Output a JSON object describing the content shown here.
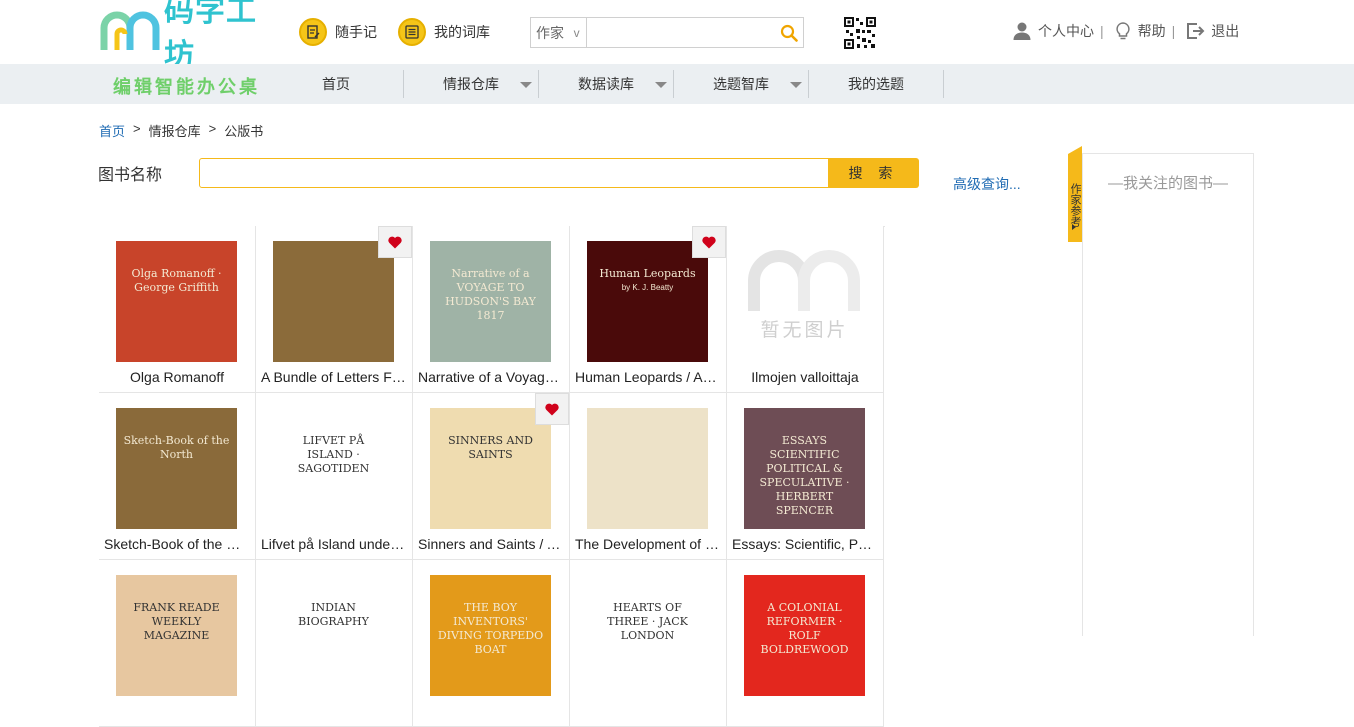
{
  "header": {
    "logo_text": "码字工坊",
    "quick_links": [
      {
        "label": "随手记",
        "icon": "note-edit-icon"
      },
      {
        "label": "我的词库",
        "icon": "list-icon"
      }
    ],
    "search": {
      "type_selected": "作家",
      "type_arrow": "v",
      "placeholder": ""
    },
    "user": {
      "center": "个人中心",
      "help": "帮助",
      "logout": "退出",
      "separator": "|"
    }
  },
  "nav": {
    "brand": "编辑智能办公桌",
    "items": [
      {
        "label": "首页",
        "has_dropdown": false
      },
      {
        "label": "情报仓库",
        "has_dropdown": true
      },
      {
        "label": "数据读库",
        "has_dropdown": true
      },
      {
        "label": "选题智库",
        "has_dropdown": true
      },
      {
        "label": "我的选题",
        "has_dropdown": false
      }
    ]
  },
  "breadcrumb": {
    "home": "首页",
    "level2": "情报仓库",
    "level3": "公版书",
    "sep": ">"
  },
  "book_search": {
    "label": "图书名称",
    "button": "搜 索",
    "advanced": "高级查询...",
    "value": ""
  },
  "side": {
    "tab": "作家参考",
    "panel_title": "—我关注的图书—"
  },
  "books": [
    {
      "title": "Olga Romanoff",
      "fav": false,
      "cover_text": "Olga Romanoff · George Griffith",
      "cover_bg": "#c8442a"
    },
    {
      "title": "A Bundle of Letters From Over the Sea",
      "fav": true,
      "cover_text": "",
      "cover_bg": "#8b6b3a"
    },
    {
      "title": "Narrative of a Voyage to Hudson's Bay",
      "fav": false,
      "cover_text": "Narrative of a VOYAGE TO HUDSON'S BAY 1817",
      "cover_bg": "#9fb3a6"
    },
    {
      "title": "Human Leopards / An Account",
      "fav": true,
      "cover_text": "Human Leopards",
      "cover_sub": "by K. J. Beatty",
      "cover_bg": "#4a0a0a"
    },
    {
      "title": "Ilmojen valloittaja",
      "fav": false,
      "cover_text": "暂无图片",
      "cover_bg": "#ffffff"
    },
    {
      "title": "Sketch-Book of the North",
      "fav": false,
      "cover_text": "Sketch-Book of the North",
      "cover_bg": "#8a6a3a"
    },
    {
      "title": "Lifvet på Island under Sagotiden",
      "fav": false,
      "cover_text": "LIFVET PÅ ISLAND · SAGOTIDEN",
      "cover_bg": "#ffffff"
    },
    {
      "title": "Sinners and Saints / A Tour",
      "fav": true,
      "cover_text": "SINNERS AND SAINTS",
      "cover_bg": "#efdcb0"
    },
    {
      "title": "The Development of the Feudal System",
      "fav": false,
      "cover_text": "",
      "cover_bg": "#ede2c8"
    },
    {
      "title": "Essays: Scientific, Political, & Speculative",
      "fav": false,
      "cover_text": "ESSAYS SCIENTIFIC POLITICAL & SPECULATIVE · HERBERT SPENCER",
      "cover_bg": "#6e4d55"
    },
    {
      "title": "",
      "fav": false,
      "cover_text": "FRANK READE WEEKLY MAGAZINE",
      "cover_bg": "#e7c7a0"
    },
    {
      "title": "",
      "fav": false,
      "cover_text": "INDIAN BIOGRAPHY",
      "cover_bg": "#ffffff"
    },
    {
      "title": "",
      "fav": false,
      "cover_text": "THE BOY INVENTORS' DIVING TORPEDO BOAT",
      "cover_bg": "#e39a1a"
    },
    {
      "title": "",
      "fav": false,
      "cover_text": "HEARTS OF THREE · JACK LONDON",
      "cover_bg": "#ffffff"
    },
    {
      "title": "",
      "fav": false,
      "cover_text": "A COLONIAL REFORMER · ROLF BOLDREWOOD",
      "cover_bg": "#e3271e"
    }
  ]
}
